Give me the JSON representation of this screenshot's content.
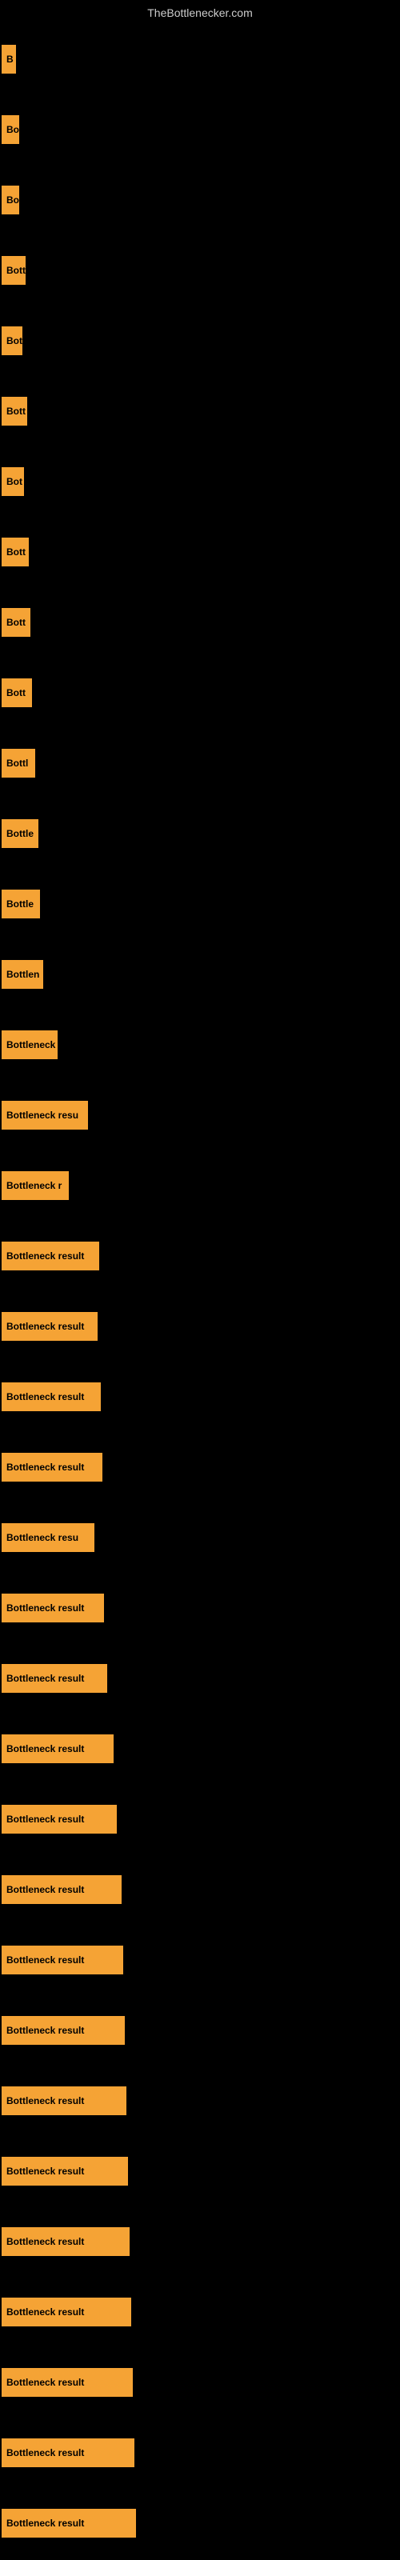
{
  "site": {
    "title": "TheBottlenecker.com"
  },
  "bars": [
    {
      "label": "B",
      "width": 18
    },
    {
      "label": "Bo",
      "width": 22
    },
    {
      "label": "Bo",
      "width": 22
    },
    {
      "label": "Bott",
      "width": 30
    },
    {
      "label": "Bot",
      "width": 26
    },
    {
      "label": "Bott",
      "width": 32
    },
    {
      "label": "Bot",
      "width": 28
    },
    {
      "label": "Bott",
      "width": 34
    },
    {
      "label": "Bott",
      "width": 36
    },
    {
      "label": "Bott",
      "width": 38
    },
    {
      "label": "Bottl",
      "width": 42
    },
    {
      "label": "Bottle",
      "width": 46
    },
    {
      "label": "Bottle",
      "width": 48
    },
    {
      "label": "Bottlen",
      "width": 52
    },
    {
      "label": "Bottleneck",
      "width": 70
    },
    {
      "label": "Bottleneck resu",
      "width": 108
    },
    {
      "label": "Bottleneck r",
      "width": 84
    },
    {
      "label": "Bottleneck result",
      "width": 122
    },
    {
      "label": "Bottleneck result",
      "width": 120
    },
    {
      "label": "Bottleneck result",
      "width": 124
    },
    {
      "label": "Bottleneck result",
      "width": 126
    },
    {
      "label": "Bottleneck resu",
      "width": 116
    },
    {
      "label": "Bottleneck result",
      "width": 128
    },
    {
      "label": "Bottleneck result",
      "width": 132
    },
    {
      "label": "Bottleneck result",
      "width": 140
    },
    {
      "label": "Bottleneck result",
      "width": 144
    },
    {
      "label": "Bottleneck result",
      "width": 150
    },
    {
      "label": "Bottleneck result",
      "width": 152
    },
    {
      "label": "Bottleneck result",
      "width": 154
    },
    {
      "label": "Bottleneck result",
      "width": 156
    },
    {
      "label": "Bottleneck result",
      "width": 158
    },
    {
      "label": "Bottleneck result",
      "width": 160
    },
    {
      "label": "Bottleneck result",
      "width": 162
    },
    {
      "label": "Bottleneck result",
      "width": 164
    },
    {
      "label": "Bottleneck result",
      "width": 166
    },
    {
      "label": "Bottleneck result",
      "width": 168
    }
  ]
}
